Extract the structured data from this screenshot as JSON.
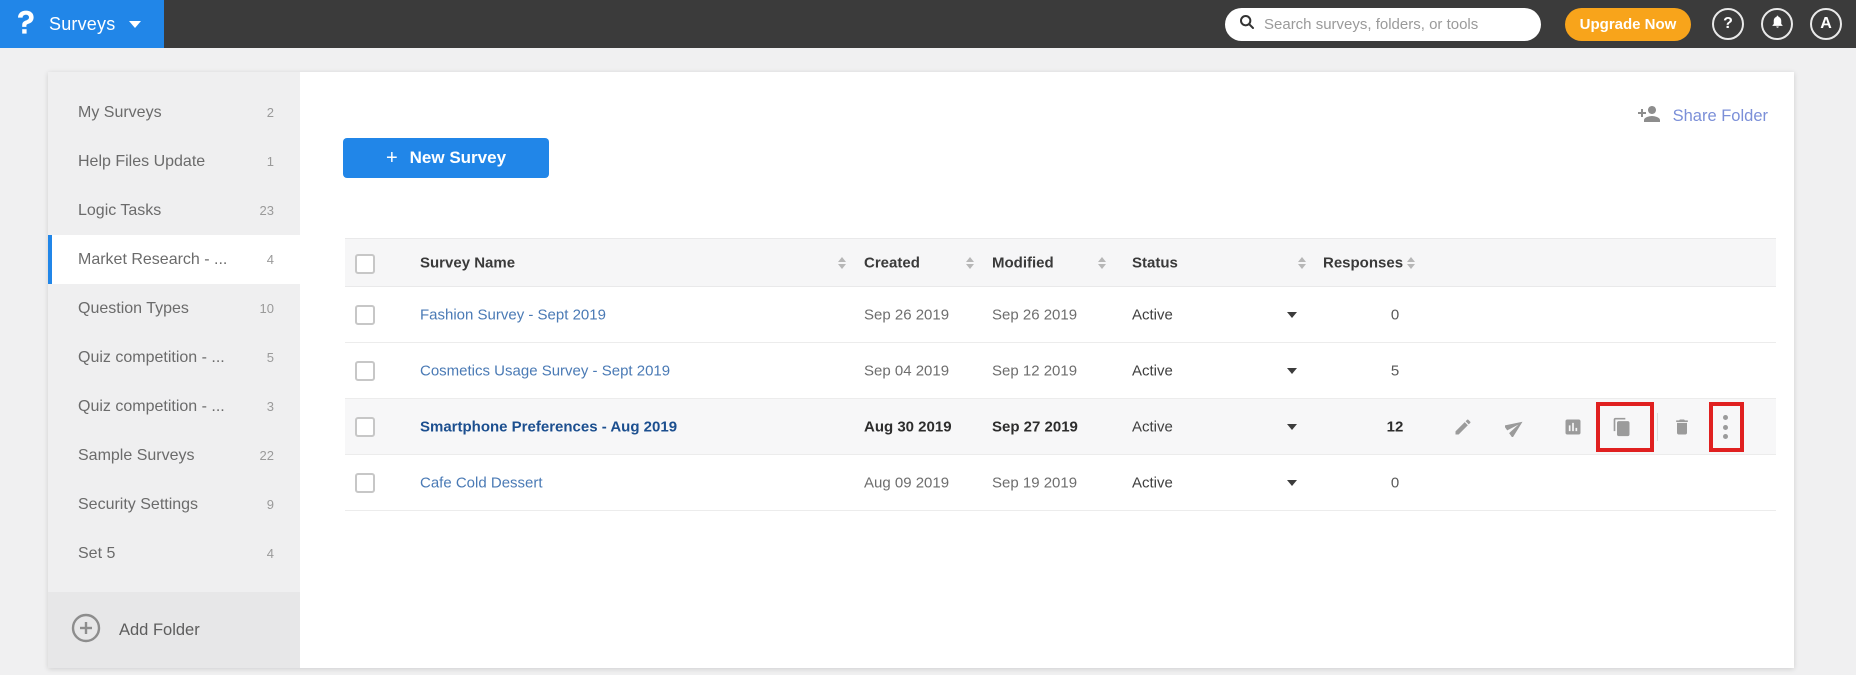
{
  "topbar": {
    "app_name": "Surveys",
    "search_placeholder": "Search surveys, folders, or tools",
    "upgrade_label": "Upgrade Now",
    "help_glyph": "?",
    "avatar_initial": "A"
  },
  "sidebar": {
    "items": [
      {
        "label": "My Surveys",
        "count": "2"
      },
      {
        "label": "Help Files Update",
        "count": "1"
      },
      {
        "label": "Logic Tasks",
        "count": "23"
      },
      {
        "label": "Market Research - ...",
        "count": "4"
      },
      {
        "label": "Question Types",
        "count": "10"
      },
      {
        "label": "Quiz competition - ...",
        "count": "5"
      },
      {
        "label": "Quiz competition - ...",
        "count": "3"
      },
      {
        "label": "Sample Surveys",
        "count": "22"
      },
      {
        "label": "Security Settings",
        "count": "9"
      },
      {
        "label": "Set 5",
        "count": "4"
      }
    ],
    "selected_item": "Market Research - ...",
    "add_folder_label": "Add Folder"
  },
  "content": {
    "new_survey": {
      "icon": "+",
      "label": "New Survey"
    },
    "share_folder_label": "Share Folder",
    "table": {
      "columns": {
        "name": "Survey Name",
        "created": "Created",
        "modified": "Modified",
        "status": "Status",
        "responses": "Responses"
      },
      "rows": [
        {
          "name": "Fashion Survey - Sept 2019",
          "created": "Sep 26 2019",
          "modified": "Sep 26 2019",
          "status": "Active",
          "responses": "0"
        },
        {
          "name": "Cosmetics Usage Survey - Sept 2019",
          "created": "Sep 04 2019",
          "modified": "Sep 12 2019",
          "status": "Active",
          "responses": "5"
        },
        {
          "name": "Smartphone Preferences - Aug 2019",
          "created": "Aug 30 2019",
          "modified": "Sep 27 2019",
          "status": "Active",
          "responses": "12",
          "emphasized": true,
          "actions": [
            "edit",
            "send",
            "reports",
            "duplicate",
            "delete",
            "more"
          ]
        },
        {
          "name": "Cafe Cold Dessert",
          "created": "Aug 09 2019",
          "modified": "Sep 19 2019",
          "status": "Active",
          "responses": "0"
        }
      ]
    }
  },
  "annotations": {
    "highlighted_actions": [
      "duplicate",
      "more"
    ]
  },
  "colors": {
    "accent_blue": "#2186e8",
    "topbar_gray": "#3b3b3b",
    "upgrade_orange": "#f8a41b",
    "highlight_red": "#e02020",
    "survey_link_blue": "#4a7ab5",
    "share_link_blue": "#7b8fd8"
  }
}
